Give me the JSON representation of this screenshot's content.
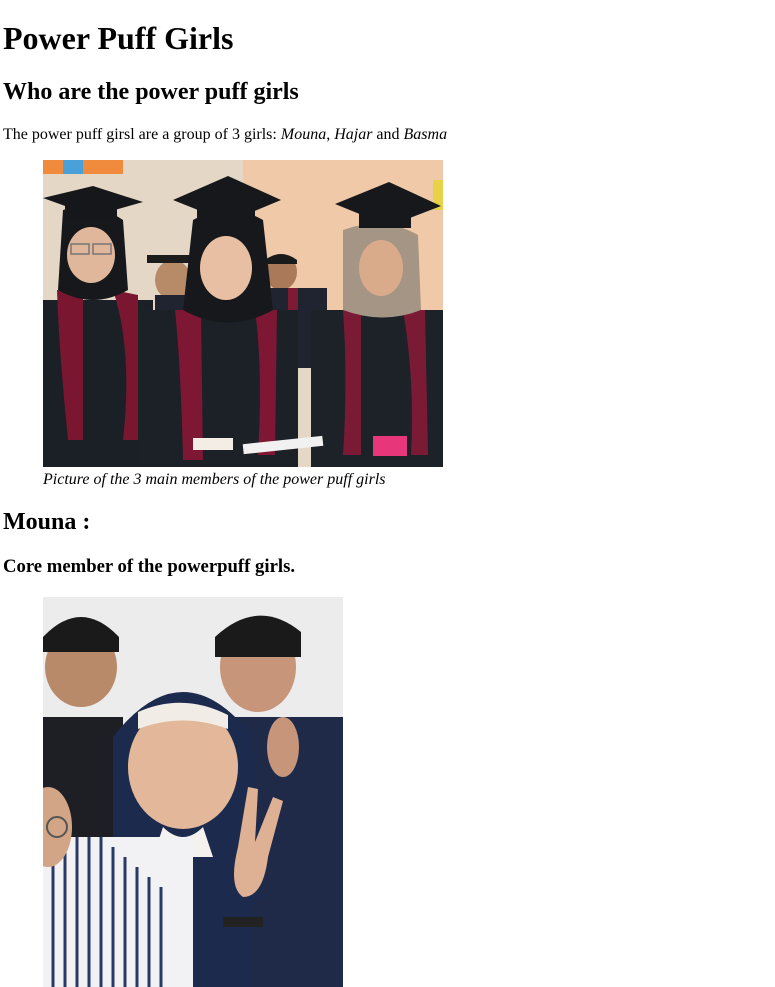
{
  "page": {
    "title": "Power Puff Girls",
    "intro_heading": "Who are the power puff girls",
    "intro_prefix": "The power puff girsl are a group of 3 girls: ",
    "members": [
      "Mouna",
      "Hajar",
      "Basma"
    ],
    "sep1": ", ",
    "sep2": " and ",
    "group_caption": "Picture of the 3 main members of the power puff girls",
    "member_heading": "Mouna :",
    "member_role": "Core member of the powerpuff girls."
  }
}
